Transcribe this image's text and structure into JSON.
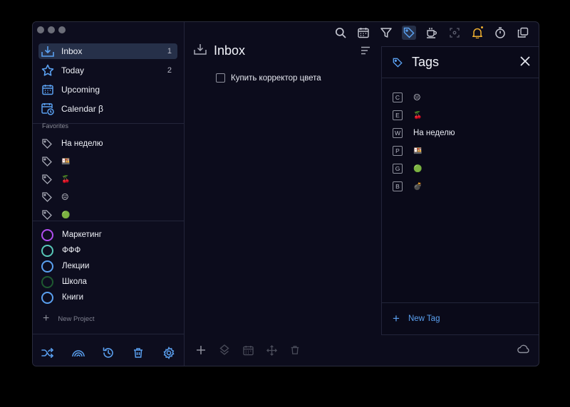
{
  "sidebar": {
    "nav": [
      {
        "label": "Inbox",
        "count": "1",
        "icon": "inbox-icon"
      },
      {
        "label": "Today",
        "count": "2",
        "icon": "star-icon"
      },
      {
        "label": "Upcoming",
        "count": "",
        "icon": "calendar-icon"
      },
      {
        "label": "Calendar β",
        "count": "",
        "icon": "calendar-clock-icon"
      }
    ],
    "favorites_label": "Favorites",
    "favorites": [
      {
        "label": "На неделю"
      },
      {
        "label": "🍱"
      },
      {
        "label": "🍒"
      },
      {
        "label": "😐"
      },
      {
        "label": "🟢"
      }
    ],
    "projects": [
      {
        "label": "Маркетинг",
        "color": "#b04ef0"
      },
      {
        "label": "ФФФ",
        "color": "#58c8b8"
      },
      {
        "label": "Лекции",
        "color": "#5aa0f0"
      },
      {
        "label": "Школа",
        "color": "#1e5a30"
      },
      {
        "label": "Книги",
        "color": "#5aa0f0"
      }
    ],
    "new_project": "New Project"
  },
  "main": {
    "title": "Inbox",
    "tasks": [
      {
        "label": "Купить корректор цвета",
        "done": false
      }
    ]
  },
  "tags_panel": {
    "title": "Tags",
    "tags": [
      {
        "key": "C",
        "label": "😐"
      },
      {
        "key": "E",
        "label": "🍒"
      },
      {
        "key": "W",
        "label": "На неделю"
      },
      {
        "key": "P",
        "label": "🍱"
      },
      {
        "key": "G",
        "label": "🟢"
      },
      {
        "key": "B",
        "label": "💣"
      }
    ],
    "new_tag": "New Tag"
  },
  "colors": {
    "accent": "#5aa0f0",
    "bell": "#f0b030",
    "bg": "#0c0c1c"
  }
}
